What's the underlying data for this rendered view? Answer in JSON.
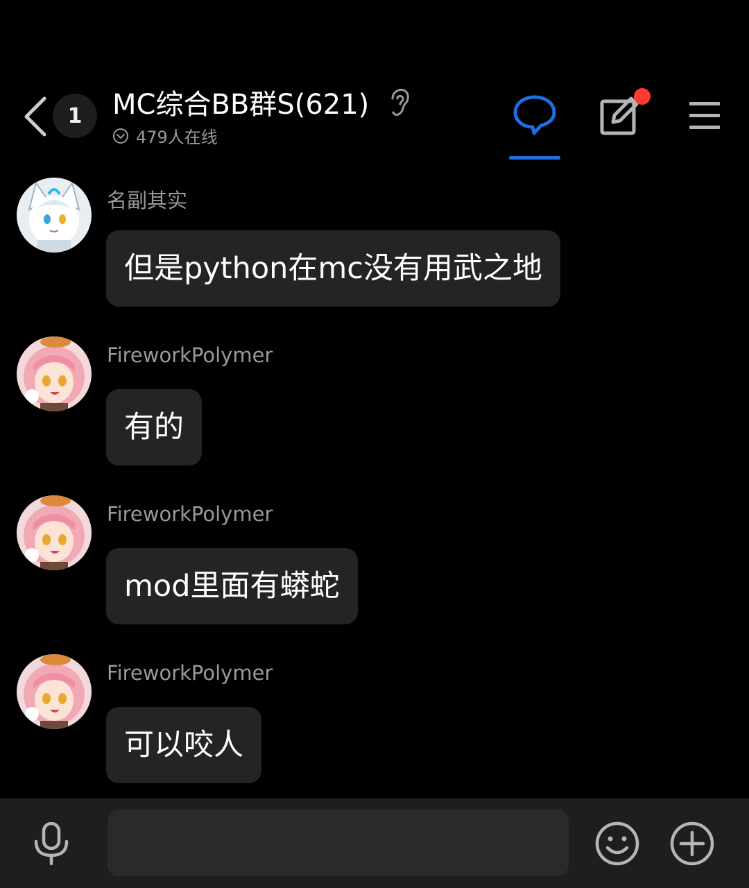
{
  "header": {
    "unread_count": "1",
    "title": "MC综合BB群S(621)",
    "online_text": "479人在线",
    "active_tab": "chat",
    "compose_has_notification": true
  },
  "messages": [
    {
      "sender": "名副其实",
      "text": "但是python在mc没有用武之地",
      "avatar": "white-cat-avatar"
    },
    {
      "sender": "FireworkPolymer",
      "text": "有的",
      "avatar": "pink-hair-avatar"
    },
    {
      "sender": "FireworkPolymer",
      "text": "mod里面有蟒蛇",
      "avatar": "pink-hair-avatar"
    },
    {
      "sender": "FireworkPolymer",
      "text": "可以咬人",
      "avatar": "pink-hair-avatar"
    }
  ],
  "input": {
    "placeholder": "",
    "value": ""
  },
  "colors": {
    "accent": "#1e6fe0",
    "notification": "#ff3b30",
    "bubble": "#242424",
    "background": "#000000"
  }
}
